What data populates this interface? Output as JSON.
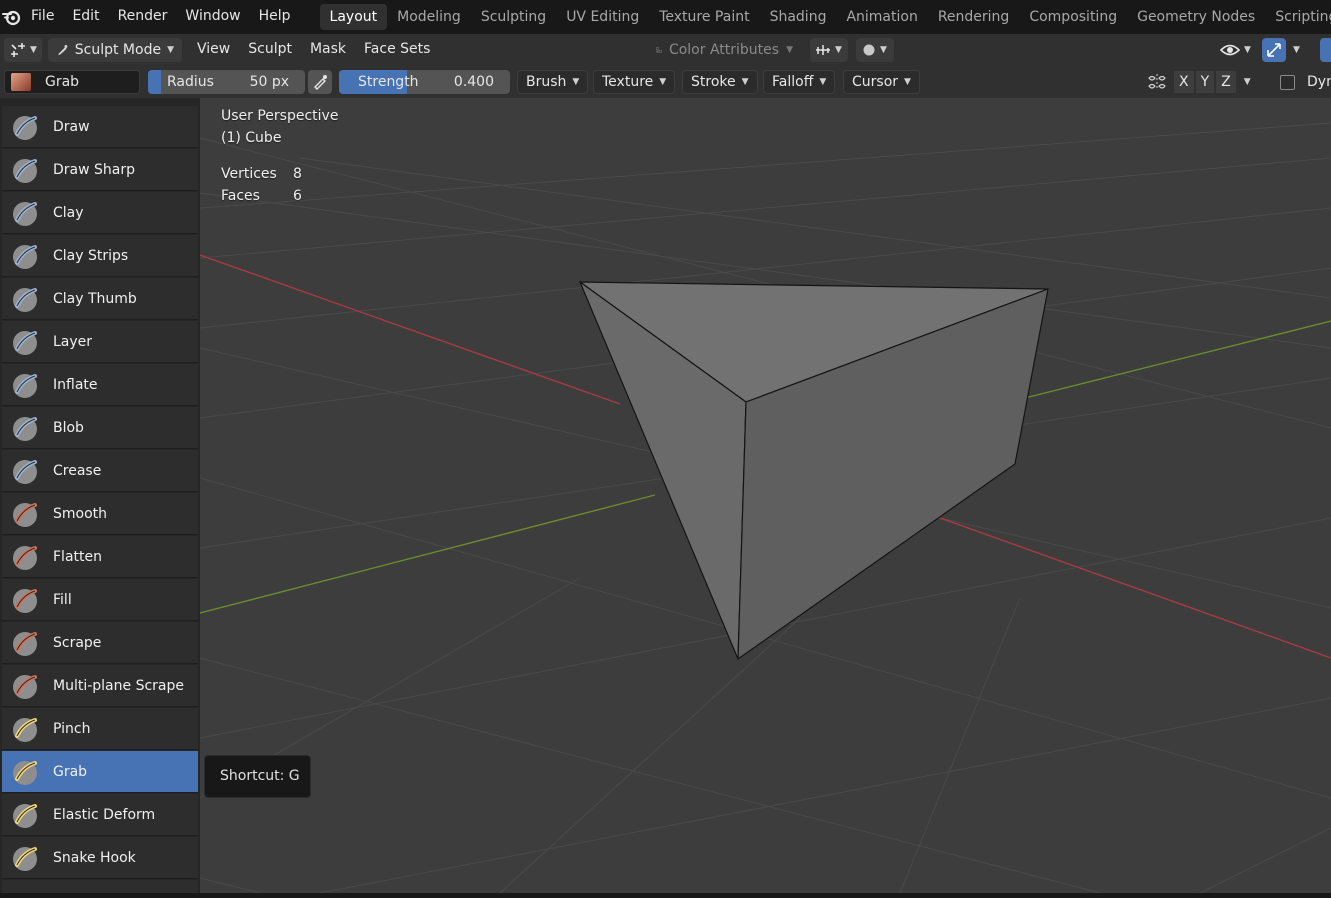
{
  "menu": {
    "logo_icon": "blender-logo-icon",
    "items": [
      "File",
      "Edit",
      "Render",
      "Window",
      "Help"
    ]
  },
  "workspaces": {
    "tabs": [
      "Layout",
      "Modeling",
      "Sculpting",
      "UV Editing",
      "Texture Paint",
      "Shading",
      "Animation",
      "Rendering",
      "Compositing",
      "Geometry Nodes",
      "Scripting"
    ],
    "active": "Layout"
  },
  "header": {
    "editor_type_icon": "3d-viewport-icon",
    "mode": "Sculpt Mode",
    "menus": [
      "View",
      "Sculpt",
      "Mask",
      "Face Sets"
    ],
    "color_attributes": "Color Attributes"
  },
  "tool_settings": {
    "brush_name": "Grab",
    "radius_label": "Radius",
    "radius_value": "50 px",
    "strength_label": "Strength",
    "strength_value": "0.400",
    "strength_fraction": 0.4,
    "dropdowns": [
      "Brush",
      "Texture",
      "Stroke",
      "Falloff",
      "Cursor"
    ],
    "symmetry_axes": [
      "X",
      "Y",
      "Z"
    ],
    "dyntopo_label": "Dyn"
  },
  "viewport": {
    "view_name": "User Perspective",
    "object_name": "(1) Cube",
    "stats": [
      {
        "label": "Vertices",
        "value": "8"
      },
      {
        "label": "Faces",
        "value": "6"
      }
    ]
  },
  "tools": [
    {
      "label": "Draw",
      "icon": "draw-brush-icon"
    },
    {
      "label": "Draw Sharp",
      "icon": "draw-sharp-brush-icon"
    },
    {
      "label": "Clay",
      "icon": "clay-brush-icon"
    },
    {
      "label": "Clay Strips",
      "icon": "clay-strips-brush-icon"
    },
    {
      "label": "Clay Thumb",
      "icon": "clay-thumb-brush-icon"
    },
    {
      "label": "Layer",
      "icon": "layer-brush-icon"
    },
    {
      "label": "Inflate",
      "icon": "inflate-brush-icon"
    },
    {
      "label": "Blob",
      "icon": "blob-brush-icon"
    },
    {
      "label": "Crease",
      "icon": "crease-brush-icon"
    },
    {
      "label": "Smooth",
      "icon": "smooth-brush-icon"
    },
    {
      "label": "Flatten",
      "icon": "flatten-brush-icon"
    },
    {
      "label": "Fill",
      "icon": "fill-brush-icon"
    },
    {
      "label": "Scrape",
      "icon": "scrape-brush-icon"
    },
    {
      "label": "Multi-plane Scrape",
      "icon": "multiplane-scrape-brush-icon"
    },
    {
      "label": "Pinch",
      "icon": "pinch-brush-icon"
    },
    {
      "label": "Grab",
      "icon": "grab-brush-icon"
    },
    {
      "label": "Elastic Deform",
      "icon": "elastic-deform-brush-icon"
    },
    {
      "label": "Snake Hook",
      "icon": "snake-hook-brush-icon"
    }
  ],
  "active_tool": "Grab",
  "tooltip": {
    "text": "Shortcut: G"
  },
  "colors": {
    "accent": "#4772b3",
    "x_axis": "#a83a44",
    "y_axis": "#6d8a2c",
    "brush_blue": "#9ab4d6",
    "brush_red": "#d1735a",
    "brush_yellow": "#f2d779"
  }
}
